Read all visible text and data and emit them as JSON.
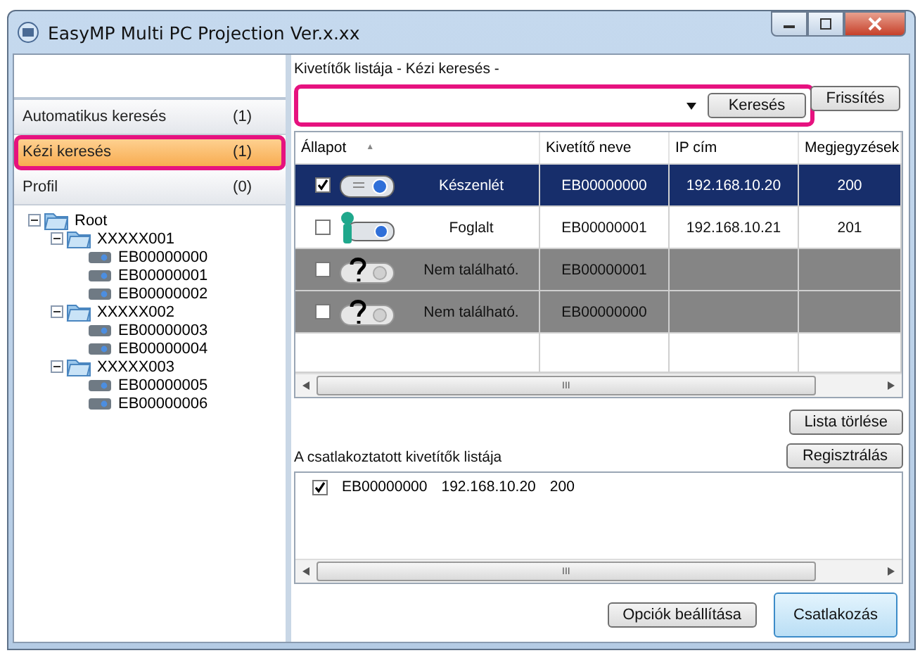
{
  "window": {
    "title": "EasyMP Multi PC Projection Ver.x.xx"
  },
  "sidebar": {
    "items": [
      {
        "label": "Automatikus keresés",
        "count": "(1)",
        "selected": false,
        "highlighted": false
      },
      {
        "label": "Kézi keresés",
        "count": "(1)",
        "selected": true,
        "highlighted": true
      },
      {
        "label": "Profil",
        "count": "(0)",
        "selected": false,
        "highlighted": false
      }
    ],
    "tree": [
      {
        "label": "Root",
        "expanded": true,
        "kind": "folder",
        "children": [
          {
            "label": "XXXXX001",
            "expanded": true,
            "kind": "folder",
            "children": [
              {
                "label": "EB00000000",
                "kind": "device"
              },
              {
                "label": "EB00000001",
                "kind": "device"
              },
              {
                "label": "EB00000002",
                "kind": "device"
              }
            ]
          },
          {
            "label": "XXXXX002",
            "expanded": true,
            "kind": "folder",
            "children": [
              {
                "label": "EB00000003",
                "kind": "device"
              },
              {
                "label": "EB00000004",
                "kind": "device"
              }
            ]
          },
          {
            "label": "XXXXX003",
            "expanded": true,
            "kind": "folder",
            "children": [
              {
                "label": "EB00000005",
                "kind": "device"
              },
              {
                "label": "EB00000006",
                "kind": "device"
              }
            ]
          }
        ]
      }
    ]
  },
  "projector_list": {
    "title": "Kivetítők listája - Kézi keresés -",
    "search_bar_highlighted": true,
    "search_button": "Keresés",
    "refresh_button": "Frissítés",
    "table": {
      "columns": [
        {
          "label": "Állapot",
          "sort": "▲"
        },
        {
          "label": "Kivetítő neve"
        },
        {
          "label": "IP cím"
        },
        {
          "label": "Megjegyzések"
        }
      ],
      "rows": [
        {
          "kind": "ready",
          "checked": true,
          "selected": true,
          "status": "Készenlét",
          "name": "EB00000000",
          "ip": "192.168.10.20",
          "note": "200"
        },
        {
          "kind": "busy",
          "checked": false,
          "selected": false,
          "status": "Foglalt",
          "name": "EB00000001",
          "ip": "192.168.10.21",
          "note": "201"
        },
        {
          "kind": "not_found",
          "checked": false,
          "selected": false,
          "status": "Nem található.",
          "name": "EB00000001",
          "ip": "",
          "note": ""
        },
        {
          "kind": "not_found",
          "checked": false,
          "selected": false,
          "status": "Nem található.",
          "name": "EB00000000",
          "ip": "",
          "note": ""
        }
      ]
    },
    "scroll_thumb": "III",
    "clear_button": "Lista törlése"
  },
  "connected": {
    "title": "A csatlakoztatott kivetítők listája",
    "register_button": "Regisztrálás",
    "items": [
      {
        "checked": true,
        "name": "EB00000000",
        "ip": "192.168.10.20",
        "note": "200"
      }
    ],
    "scroll_thumb": "III"
  },
  "buttons": {
    "options": "Opciók beállítása",
    "connect": "Csatlakozás"
  }
}
